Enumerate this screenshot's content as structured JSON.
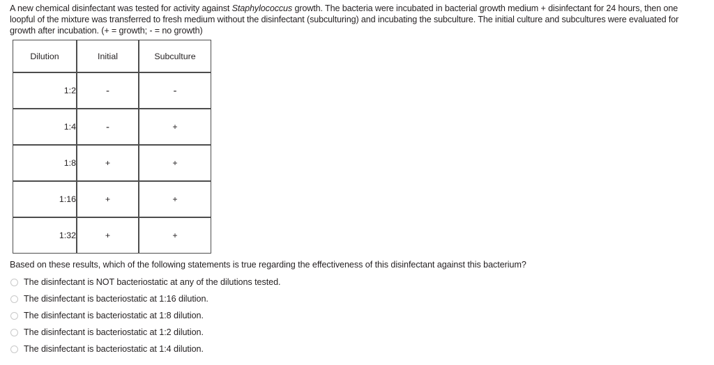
{
  "intro": {
    "part1": "A new chemical disinfectant was tested for activity against ",
    "organism": "Staphylococcus",
    "part2": " growth. The bacteria were incubated in bacterial growth medium + disinfectant for 24 hours, then one loopful of the mixture was transferred to fresh medium without the disinfectant (subculturing) and incubating the subculture. The initial culture and subcultures were evaluated for growth after incubation. (+ = growth; - = no growth)"
  },
  "table": {
    "headers": [
      "Dilution",
      "Initial",
      "Subculture"
    ],
    "rows": [
      {
        "dilution": "1:2",
        "initial": "-",
        "subculture": "-"
      },
      {
        "dilution": "1:4",
        "initial": "-",
        "subculture": "+"
      },
      {
        "dilution": "1:8",
        "initial": "+",
        "subculture": "+"
      },
      {
        "dilution": "1:16",
        "initial": "+",
        "subculture": "+"
      },
      {
        "dilution": "1:32",
        "initial": "+",
        "subculture": "+"
      }
    ]
  },
  "question": {
    "text": "Based on these results, which of the following statements is true regarding the effectiveness of this disinfectant against this bacterium?"
  },
  "options": [
    {
      "label": "The disinfectant is NOT bacteriostatic at any of the dilutions tested.",
      "selected": false
    },
    {
      "label": "The disinfectant is bacteriostatic at 1:16 dilution.",
      "selected": false
    },
    {
      "label": "The disinfectant is bacteriostatic at 1:8 dilution.",
      "selected": false
    },
    {
      "label": "The disinfectant is bacteriostatic at 1:2 dilution.",
      "selected": false
    },
    {
      "label": "The disinfectant is bacteriostatic at 1:4 dilution.",
      "selected": false
    }
  ],
  "colors": {
    "text": "#231f20",
    "table_border": "#4d4d4d",
    "radio_border": "#c9c9c9"
  }
}
